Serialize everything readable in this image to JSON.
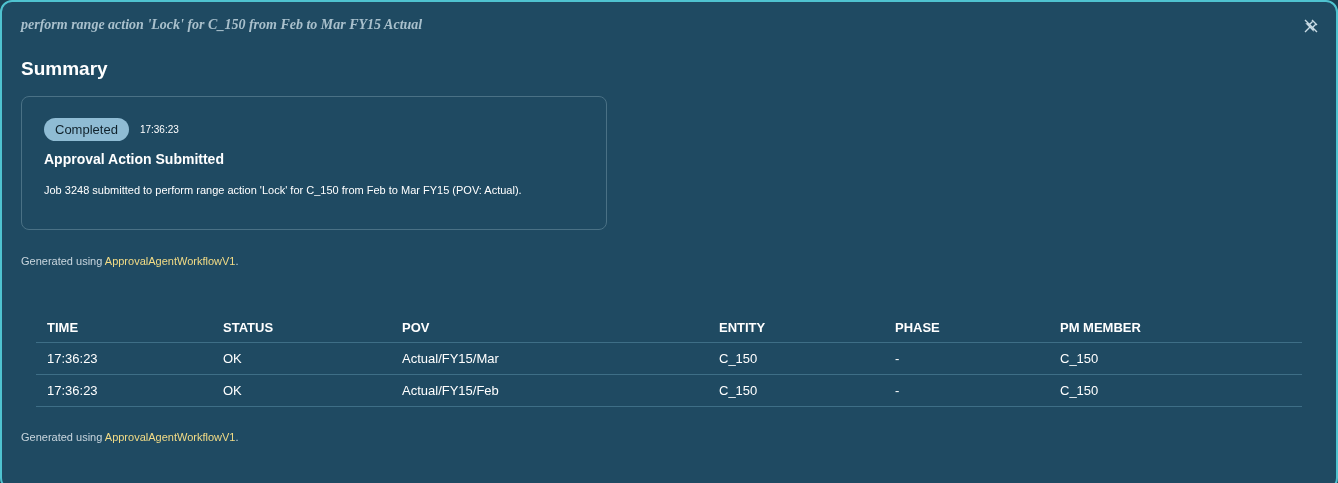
{
  "panel": {
    "title": "perform range action 'Lock' for C_150 from Feb to Mar FY15 Actual"
  },
  "summary": {
    "heading": "Summary",
    "card": {
      "badge": "Completed",
      "time": "17:36:23",
      "title": "Approval Action Submitted",
      "body": "Job 3248 submitted to perform range action 'Lock' for C_150 from Feb to Mar FY15 (POV: Actual)."
    },
    "note": {
      "prefix": "Generated using",
      "link": "ApprovalAgentWorkflowV1",
      "suffix": "."
    }
  },
  "table": {
    "columns": [
      "TIME",
      "STATUS",
      "POV",
      "ENTITY",
      "PHASE",
      "PM MEMBER"
    ],
    "rows": [
      [
        "17:36:23",
        "OK",
        "Actual/FY15/Mar",
        "C_150",
        "-",
        "C_150"
      ],
      [
        "17:36:23",
        "OK",
        "Actual/FY15/Feb",
        "C_150",
        "-",
        "C_150"
      ]
    ],
    "note": {
      "prefix": "Generated using",
      "link": "ApprovalAgentWorkflowV1",
      "suffix": "."
    }
  }
}
